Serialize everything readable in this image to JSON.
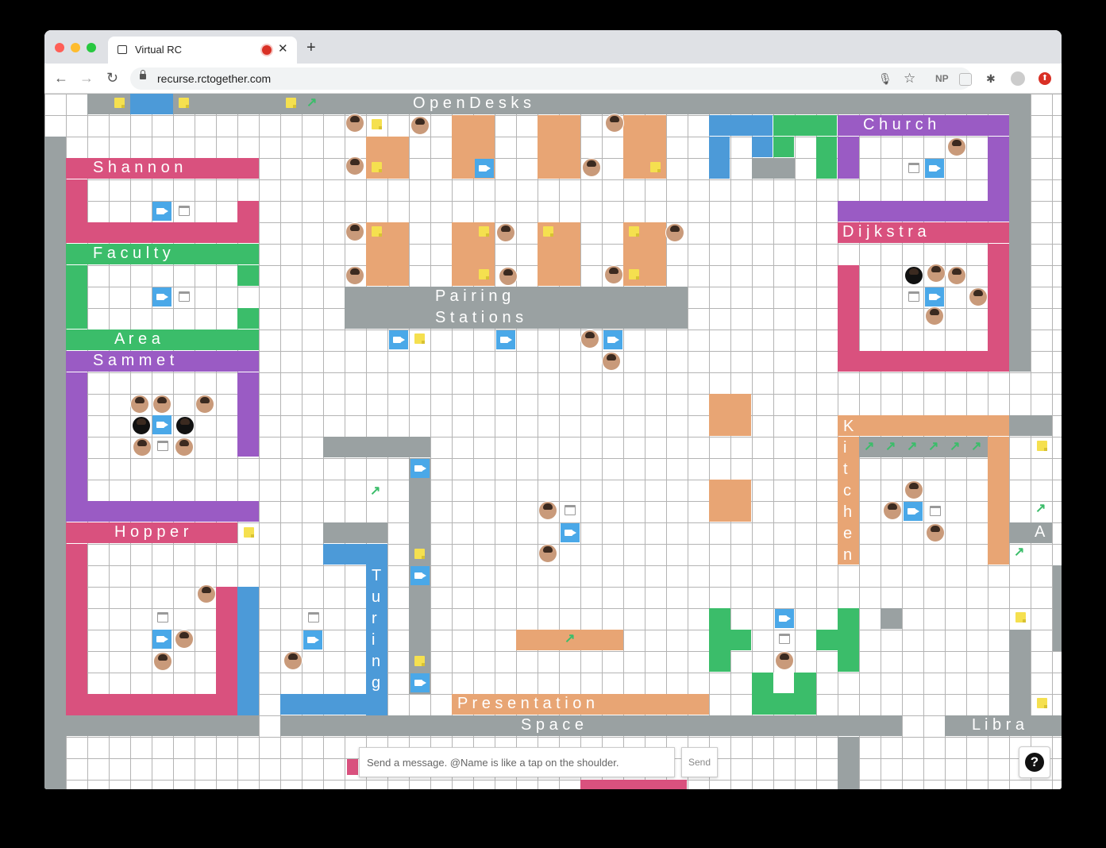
{
  "browser": {
    "tab_title": "Virtual RC",
    "url": "recurse.rctogether.com",
    "tab_close": "✕",
    "new_tab": "+",
    "back": "←",
    "forward": "→",
    "reload": "↻",
    "ext_np": "NP",
    "mic": "🎙",
    "star": "☆",
    "puzzle": "✱",
    "update": "⬆"
  },
  "rooms": {
    "open_desks": "O p e n   D e s k s",
    "church": "C h u r c h",
    "shannon": "S h a n n o n",
    "faculty": "F a c u l t y",
    "dijkstra": "D i j k s t r a",
    "pairing": "P a i r i n g",
    "stations": "S t a t i o n s",
    "area": "A r e a",
    "sammet": "S a m m e t",
    "hopper": "H o p p e r",
    "turing": "T u r i n g",
    "presentation": "P r e s e n t a t i o n",
    "space": "S p a c e",
    "libra": "L i b r a",
    "kitchen": "K i t c h e n",
    "a_partial": "A"
  },
  "chat": {
    "placeholder": "Send a message. @Name is like a tap on the shoulder.",
    "send": "Send"
  },
  "help": "?",
  "colors": {
    "gray": "#9aa1a2",
    "pink": "#d9517e",
    "green": "#3bbd6a",
    "purple": "#9a5bc4",
    "orange": "#e8a574",
    "blue": "#4c9ad8"
  }
}
